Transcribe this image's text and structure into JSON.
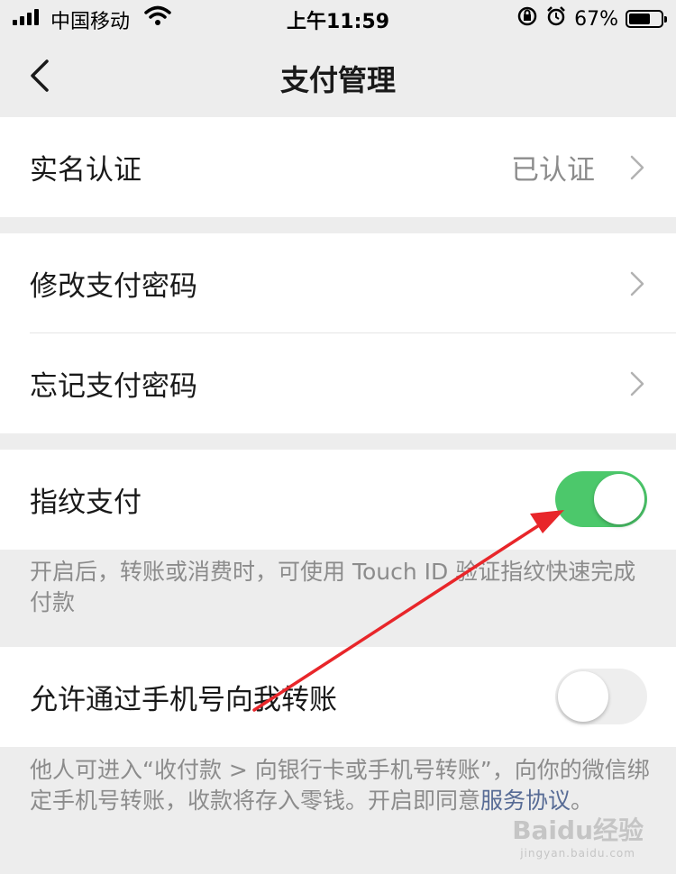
{
  "status_bar": {
    "carrier": "中国移动",
    "time": "上午11:59",
    "battery": "67%",
    "battery_level": 0.67
  },
  "nav": {
    "title": "支付管理",
    "back_icon": "chevron-left-icon"
  },
  "real_name": {
    "label": "实名认证",
    "value": "已认证"
  },
  "password_group": {
    "modify_label": "修改支付密码",
    "forgot_label": "忘记支付密码"
  },
  "fingerprint": {
    "label": "指纹支付",
    "enabled": true,
    "note": "开启后，转账或消费时，可使用 Touch ID 验证指纹快速完成付款"
  },
  "phone_transfer": {
    "label": "允许通过手机号向我转账",
    "enabled": false,
    "note_before_link": "他人可进入“收付款 > 向银行卡或手机号转账”，向你的微信绑定手机号转账，收款将存入零钱。开启即同意",
    "note_link": "服务协议",
    "note_after_link": "。"
  },
  "watermark": {
    "brand": "Baidu经验",
    "url": "jingyan.baidu.com"
  },
  "colors": {
    "toggle_on": "#4cc86b",
    "link": "#576b95",
    "annotation_arrow": "#e8262a"
  }
}
